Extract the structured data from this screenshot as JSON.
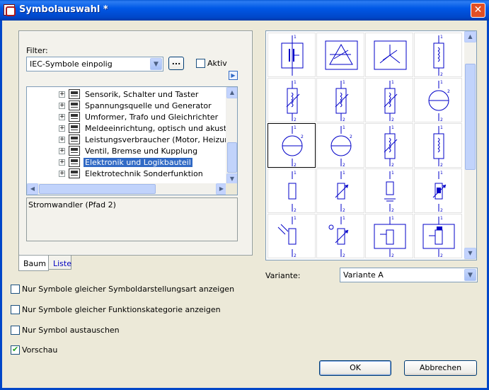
{
  "window": {
    "title": "Symbolauswahl *",
    "close_glyph": "✕",
    "icon": "app-logo-icon"
  },
  "filter": {
    "label": "Filter:",
    "selected": "IEC-Symbole einpolig",
    "browse_label": "...",
    "aktiv_label": "Aktiv",
    "aktiv_checked": false
  },
  "tree": {
    "items": [
      {
        "label": "Sensorik, Schalter und Taster",
        "selected": false
      },
      {
        "label": "Spannungsquelle und Generator",
        "selected": false
      },
      {
        "label": "Umformer, Trafo und Gleichrichter",
        "selected": false
      },
      {
        "label": "Meldeeinrichtung, optisch und akustisch",
        "selected": false
      },
      {
        "label": "Leistungsverbraucher (Motor, Heizung, Le",
        "selected": false
      },
      {
        "label": "Ventil, Bremse und Kupplung",
        "selected": false
      },
      {
        "label": "Elektronik und Logikbauteil",
        "selected": true
      },
      {
        "label": "Elektrotechnik Sonderfunktion",
        "selected": false
      }
    ]
  },
  "info": {
    "text": "Stromwandler (Pfad 2)"
  },
  "tabs": [
    {
      "label": "Baum",
      "active": true
    },
    {
      "label": "Liste",
      "active": false
    }
  ],
  "symbols": {
    "selected_index": 8,
    "items": [
      {
        "icon": "capacitor-box-symbol"
      },
      {
        "icon": "triangle-delta-symbol"
      },
      {
        "icon": "star-wye-symbol"
      },
      {
        "icon": "inductor-coil-symbol"
      },
      {
        "icon": "coil-arrow-symbol"
      },
      {
        "icon": "coil-arrow-symbol-2"
      },
      {
        "icon": "coil-arrow-symbol-3"
      },
      {
        "icon": "current-transformer-symbol"
      },
      {
        "icon": "current-transformer-symbol-2"
      },
      {
        "icon": "current-transformer-symbol-3"
      },
      {
        "icon": "coil-slash-symbol"
      },
      {
        "icon": "inductor-coil-symbol-2"
      },
      {
        "icon": "resistor-symbol"
      },
      {
        "icon": "variable-resistor-symbol"
      },
      {
        "icon": "resistor-ground-symbol"
      },
      {
        "icon": "thermistor-symbol"
      },
      {
        "icon": "photoresistor-symbol"
      },
      {
        "icon": "trimmer-resistor-symbol"
      },
      {
        "icon": "potentiometer-symbol"
      },
      {
        "icon": "potentiometer-symbol-2"
      }
    ],
    "pin_top": "1",
    "pin_bottom": "2"
  },
  "variante": {
    "label": "Variante:",
    "selected": "Variante A"
  },
  "options": [
    {
      "label": "Nur Symbole gleicher Symboldarstellungsart anzeigen",
      "checked": false
    },
    {
      "label": "Nur Symbole gleicher Funktionskategorie anzeigen",
      "checked": false
    },
    {
      "label": "Nur Symbol austauschen",
      "checked": false
    },
    {
      "label": "Vorschau",
      "checked": true
    }
  ],
  "buttons": {
    "ok": "OK",
    "cancel": "Abbrechen"
  }
}
